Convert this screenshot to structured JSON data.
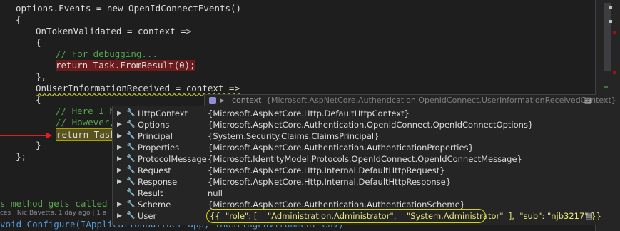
{
  "code": {
    "lines": [
      "options.Events = new OpenIdConnectEvents()",
      "{",
      "OnTokenValidated = context =>",
      "{",
      "// For debugging...",
      "return Task.FromResult(0);",
      "},",
      "OnUserInformationReceived = context =>",
      "{",
      "// Here I h",
      "// However,",
      "return Task",
      "}",
      "};"
    ],
    "method_comment": "s method gets called",
    "configure_line": "void Configure(IApplicationBuilder app, IHostingEnvironment env)",
    "codelens": "ces | Nic Bavetta, 1 day ago | 1 a"
  },
  "datatip_header": {
    "name": "context",
    "value": "{Microsoft.AspNetCore.Authentication.OpenIdConnect.UserInformationReceivedContext}",
    "icon": "field-icon"
  },
  "datatip_rows": [
    {
      "name": "HttpContext",
      "value": "{Microsoft.AspNetCore.Http.DefaultHttpContext}",
      "expandable": true,
      "icon": "wrench-icon"
    },
    {
      "name": "Options",
      "value": "{Microsoft.AspNetCore.Authentication.OpenIdConnect.OpenIdConnectOptions}",
      "expandable": true,
      "icon": "wrench-icon"
    },
    {
      "name": "Principal",
      "value": "{System.Security.Claims.ClaimsPrincipal}",
      "expandable": true,
      "icon": "wrench-icon"
    },
    {
      "name": "Properties",
      "value": "{Microsoft.AspNetCore.Authentication.AuthenticationProperties}",
      "expandable": true,
      "icon": "wrench-icon"
    },
    {
      "name": "ProtocolMessage",
      "value": "{Microsoft.IdentityModel.Protocols.OpenIdConnect.OpenIdConnectMessage}",
      "expandable": true,
      "icon": "wrench-icon"
    },
    {
      "name": "Request",
      "value": "{Microsoft.AspNetCore.Http.Internal.DefaultHttpRequest}",
      "expandable": true,
      "icon": "wrench-icon"
    },
    {
      "name": "Response",
      "value": "{Microsoft.AspNetCore.Http.Internal.DefaultHttpResponse}",
      "expandable": true,
      "icon": "wrench-icon"
    },
    {
      "name": "Result",
      "value": "null",
      "expandable": false,
      "icon": "wrench-icon"
    },
    {
      "name": "Scheme",
      "value": "{Microsoft.AspNetCore.Authentication.AuthenticationScheme}",
      "expandable": true,
      "icon": "wrench-icon"
    },
    {
      "name": "User",
      "value": "{{  \"role\": [    \"Administration.Administrator\",    \"System.Administrator\"  ],  \"sub\": \"njb3217\" }}",
      "expandable": true,
      "icon": "wrench-icon"
    }
  ],
  "colors": {
    "background": "#1e1e1e",
    "keyword": "#569cd6",
    "type": "#4ec9b0",
    "comment": "#57a64a",
    "highlight_red": "#6b1b1b",
    "annotation": "#d6d600",
    "arrow": "#e02020"
  }
}
